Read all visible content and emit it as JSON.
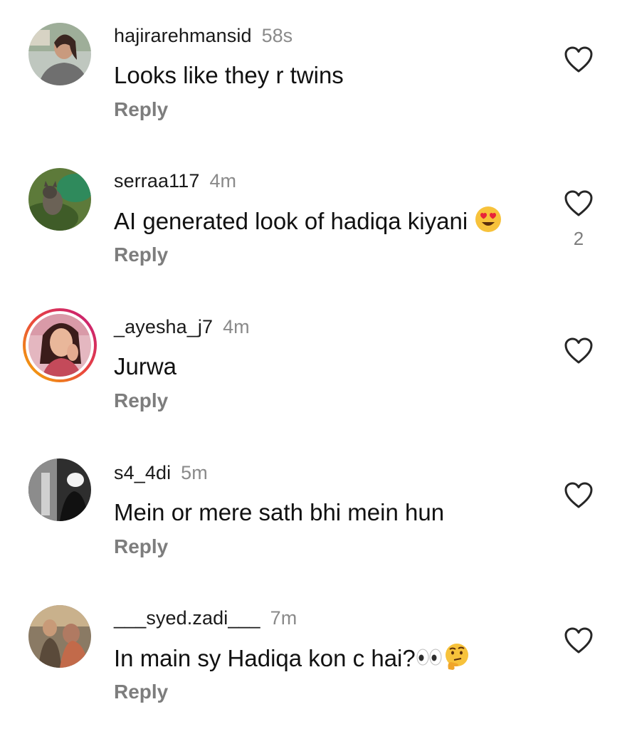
{
  "comments": [
    {
      "username": "hajirarehmansid",
      "time": "58s",
      "text": "Looks like they r twins",
      "reply_label": "Reply",
      "like_count": ""
    },
    {
      "username": "serraa117",
      "time": "4m",
      "text": "AI generated look of hadiqa kiyani ",
      "reply_label": "Reply",
      "like_count": "2",
      "emoji": "heart-eyes-emoji"
    },
    {
      "username": "_ayesha_j7",
      "time": "4m",
      "text": "Jurwa",
      "reply_label": "Reply",
      "like_count": ""
    },
    {
      "username": "s4_4di",
      "time": "5m",
      "text": "Mein or mere sath bhi mein hun",
      "reply_label": "Reply",
      "like_count": ""
    },
    {
      "username": "___syed.zadi___",
      "time": "7m",
      "text": "In main sy Hadiqa kon c hai?",
      "reply_label": "Reply",
      "like_count": "",
      "emoji": "eyes-and-thinking-emoji"
    }
  ],
  "icons": {
    "like": "heart-outline-icon"
  },
  "colors": {
    "username": "#1a1a1a",
    "timestamp": "#8a8a8a",
    "reply": "#7d7d7d",
    "story_ring_start": "#f5b400",
    "story_ring_end": "#c2187e"
  }
}
